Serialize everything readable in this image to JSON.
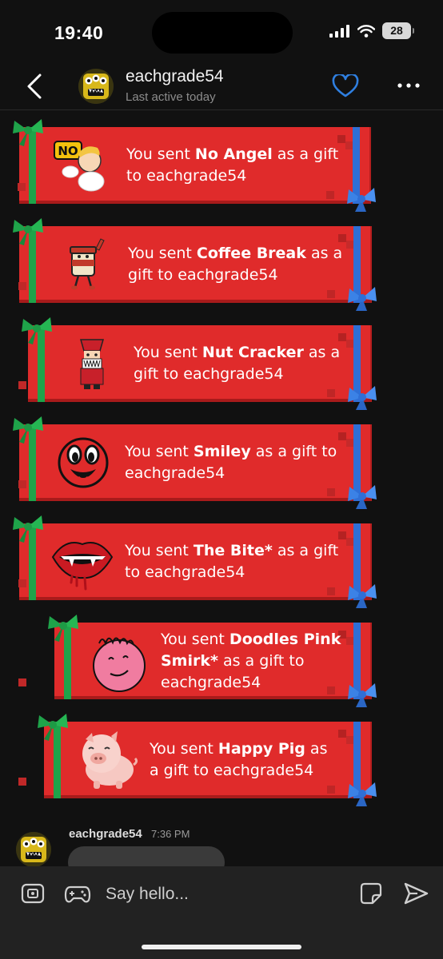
{
  "status_bar": {
    "time": "19:40",
    "battery": "28"
  },
  "header": {
    "username": "eachgrade54",
    "status": "Last active today"
  },
  "gifts": [
    {
      "prefix": "You sent ",
      "name": "No Angel",
      "suffix": " as a gift to eachgrade54",
      "sticker": "no-angel-sticker"
    },
    {
      "prefix": "You sent ",
      "name": "Coffee Break",
      "suffix": " as a gift to eachgrade54",
      "sticker": "coffee-cup-sticker"
    },
    {
      "prefix": "You sent ",
      "name": "Nut Cracker",
      "suffix": " as a gift to eachgrade54",
      "sticker": "nutcracker-sticker"
    },
    {
      "prefix": "You sent ",
      "name": "Smiley",
      "suffix": " as a gift to eachgrade54",
      "sticker": "smiley-sticker"
    },
    {
      "prefix": "You sent ",
      "name": "The Bite*",
      "suffix": " as a gift to eachgrade54",
      "sticker": "vampire-lips-sticker"
    },
    {
      "prefix": "You sent ",
      "name": "Doodles Pink Smirk*",
      "suffix": " as a gift to eachgrade54",
      "sticker": "pink-smirk-sticker"
    },
    {
      "prefix": "You sent ",
      "name": "Happy Pig",
      "suffix": " as a gift to eachgrade54",
      "sticker": "happy-pig-sticker"
    }
  ],
  "incoming": {
    "sender": "eachgrade54",
    "time": "7:36 PM"
  },
  "composer": {
    "placeholder": "Say hello..."
  },
  "colors": {
    "gift_red": "#e02b2b",
    "ribbon_green": "#1fa34a",
    "ribbon_blue": "#2f6fd6",
    "heart_blue": "#2f7fe0"
  }
}
